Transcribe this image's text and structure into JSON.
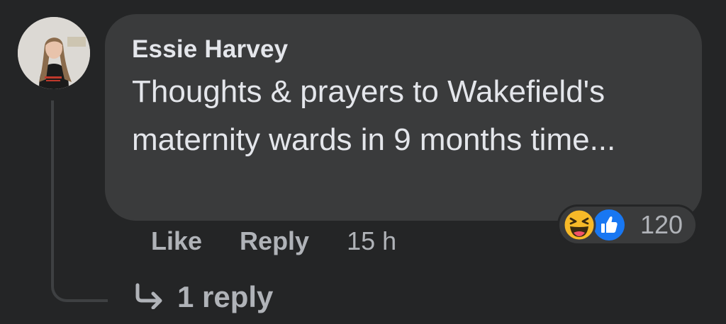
{
  "comment": {
    "author": "Essie Harvey",
    "text": "Thoughts & prayers to Wakefield's maternity wards in 9 months time...",
    "timestamp": "15 h"
  },
  "reactions": {
    "icons": [
      "haha-icon",
      "like-icon"
    ],
    "count": "120"
  },
  "actions": {
    "like_label": "Like",
    "reply_label": "Reply"
  },
  "replies": {
    "label": "1 reply"
  },
  "colors": {
    "background": "#242526",
    "bubble": "#3a3b3c",
    "primary_text": "#e4e6eb",
    "secondary_text": "#b0b3b8",
    "like_blue": "#1877f2",
    "haha_yellow": "#f7b928"
  }
}
